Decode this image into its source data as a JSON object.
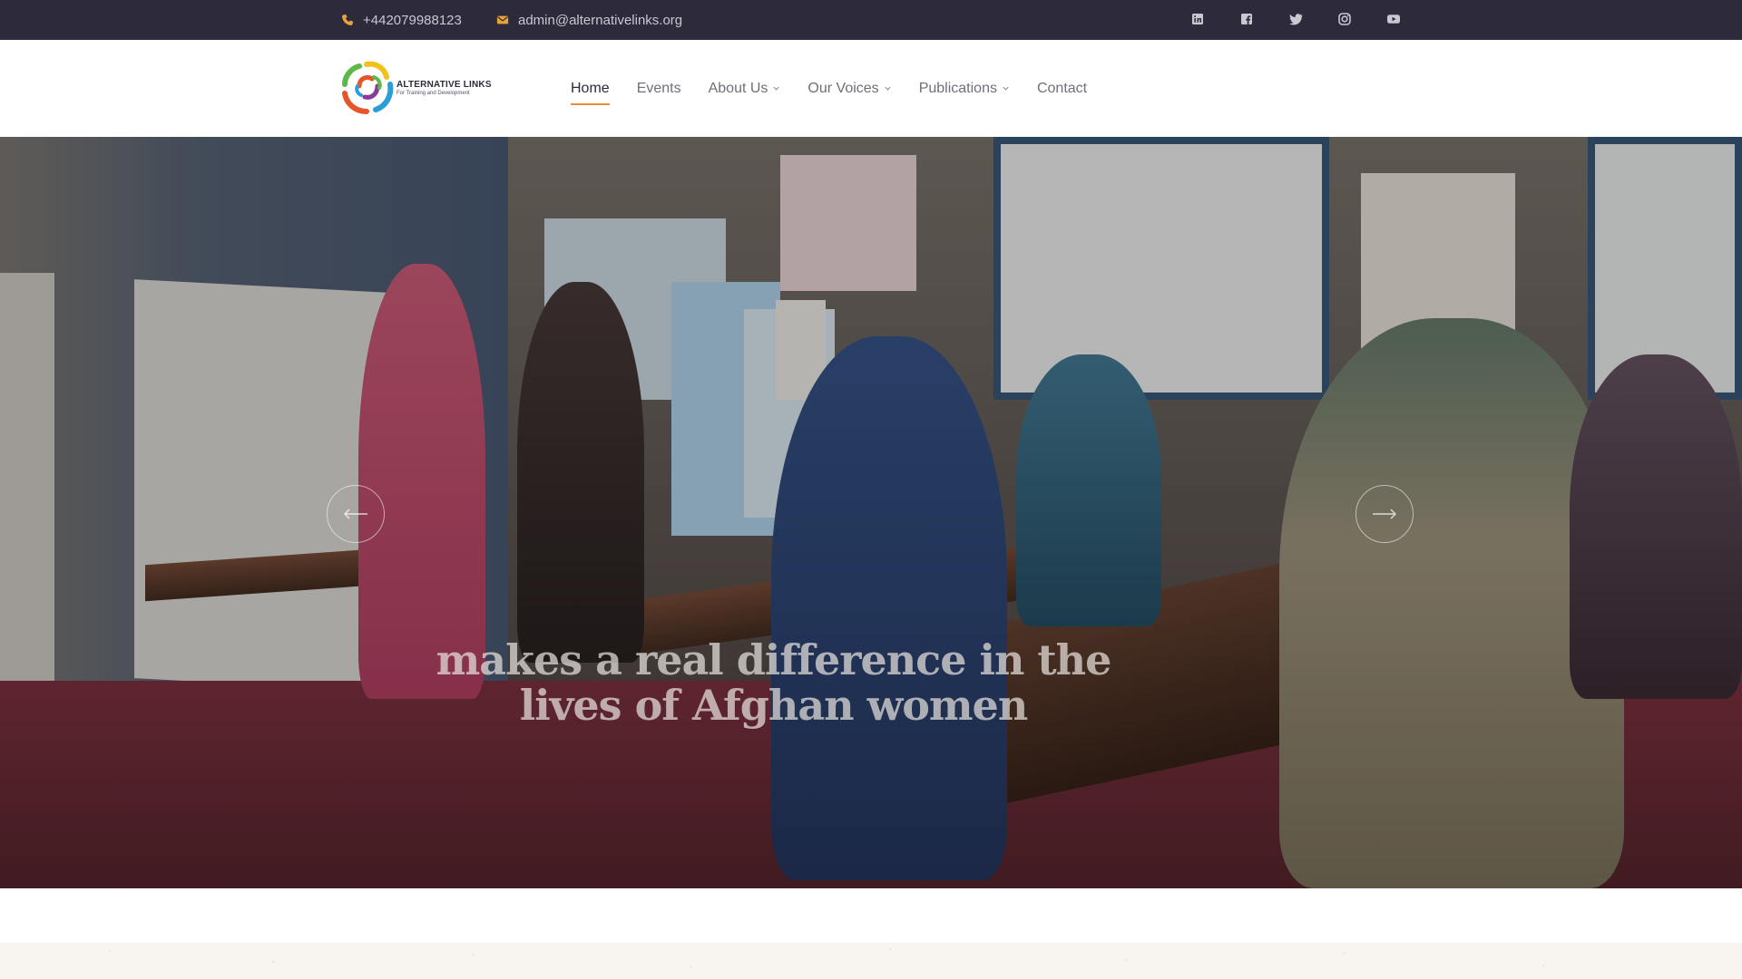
{
  "topbar": {
    "phone": "+442079988123",
    "phone_icon": "phone-icon",
    "email": "admin@alternativelinks.org",
    "email_icon": "envelope-icon",
    "social_icons": [
      "linkedin-icon",
      "facebook-icon",
      "twitter-icon",
      "instagram-icon",
      "youtube-icon"
    ]
  },
  "brand": {
    "name": "ALTERNATIVE LINKS",
    "tagline": "For Training and Development"
  },
  "nav": {
    "items": [
      {
        "label": "Home",
        "active": true,
        "dropdown": false
      },
      {
        "label": "Events",
        "active": false,
        "dropdown": false
      },
      {
        "label": "About Us",
        "active": false,
        "dropdown": true
      },
      {
        "label": "Our Voices",
        "active": false,
        "dropdown": true
      },
      {
        "label": "Publications",
        "active": false,
        "dropdown": true
      },
      {
        "label": "Contact",
        "active": false,
        "dropdown": false
      }
    ]
  },
  "hero": {
    "headline": "makes a real difference in the lives of Afghan women",
    "prev_icon": "arrow-left-icon",
    "next_icon": "arrow-right-icon"
  },
  "colors": {
    "topbar_bg": "#2c2a3b",
    "accent": "#e8903a",
    "nav_text": "#6f6e7a",
    "nav_active": "#2c2a3b"
  }
}
